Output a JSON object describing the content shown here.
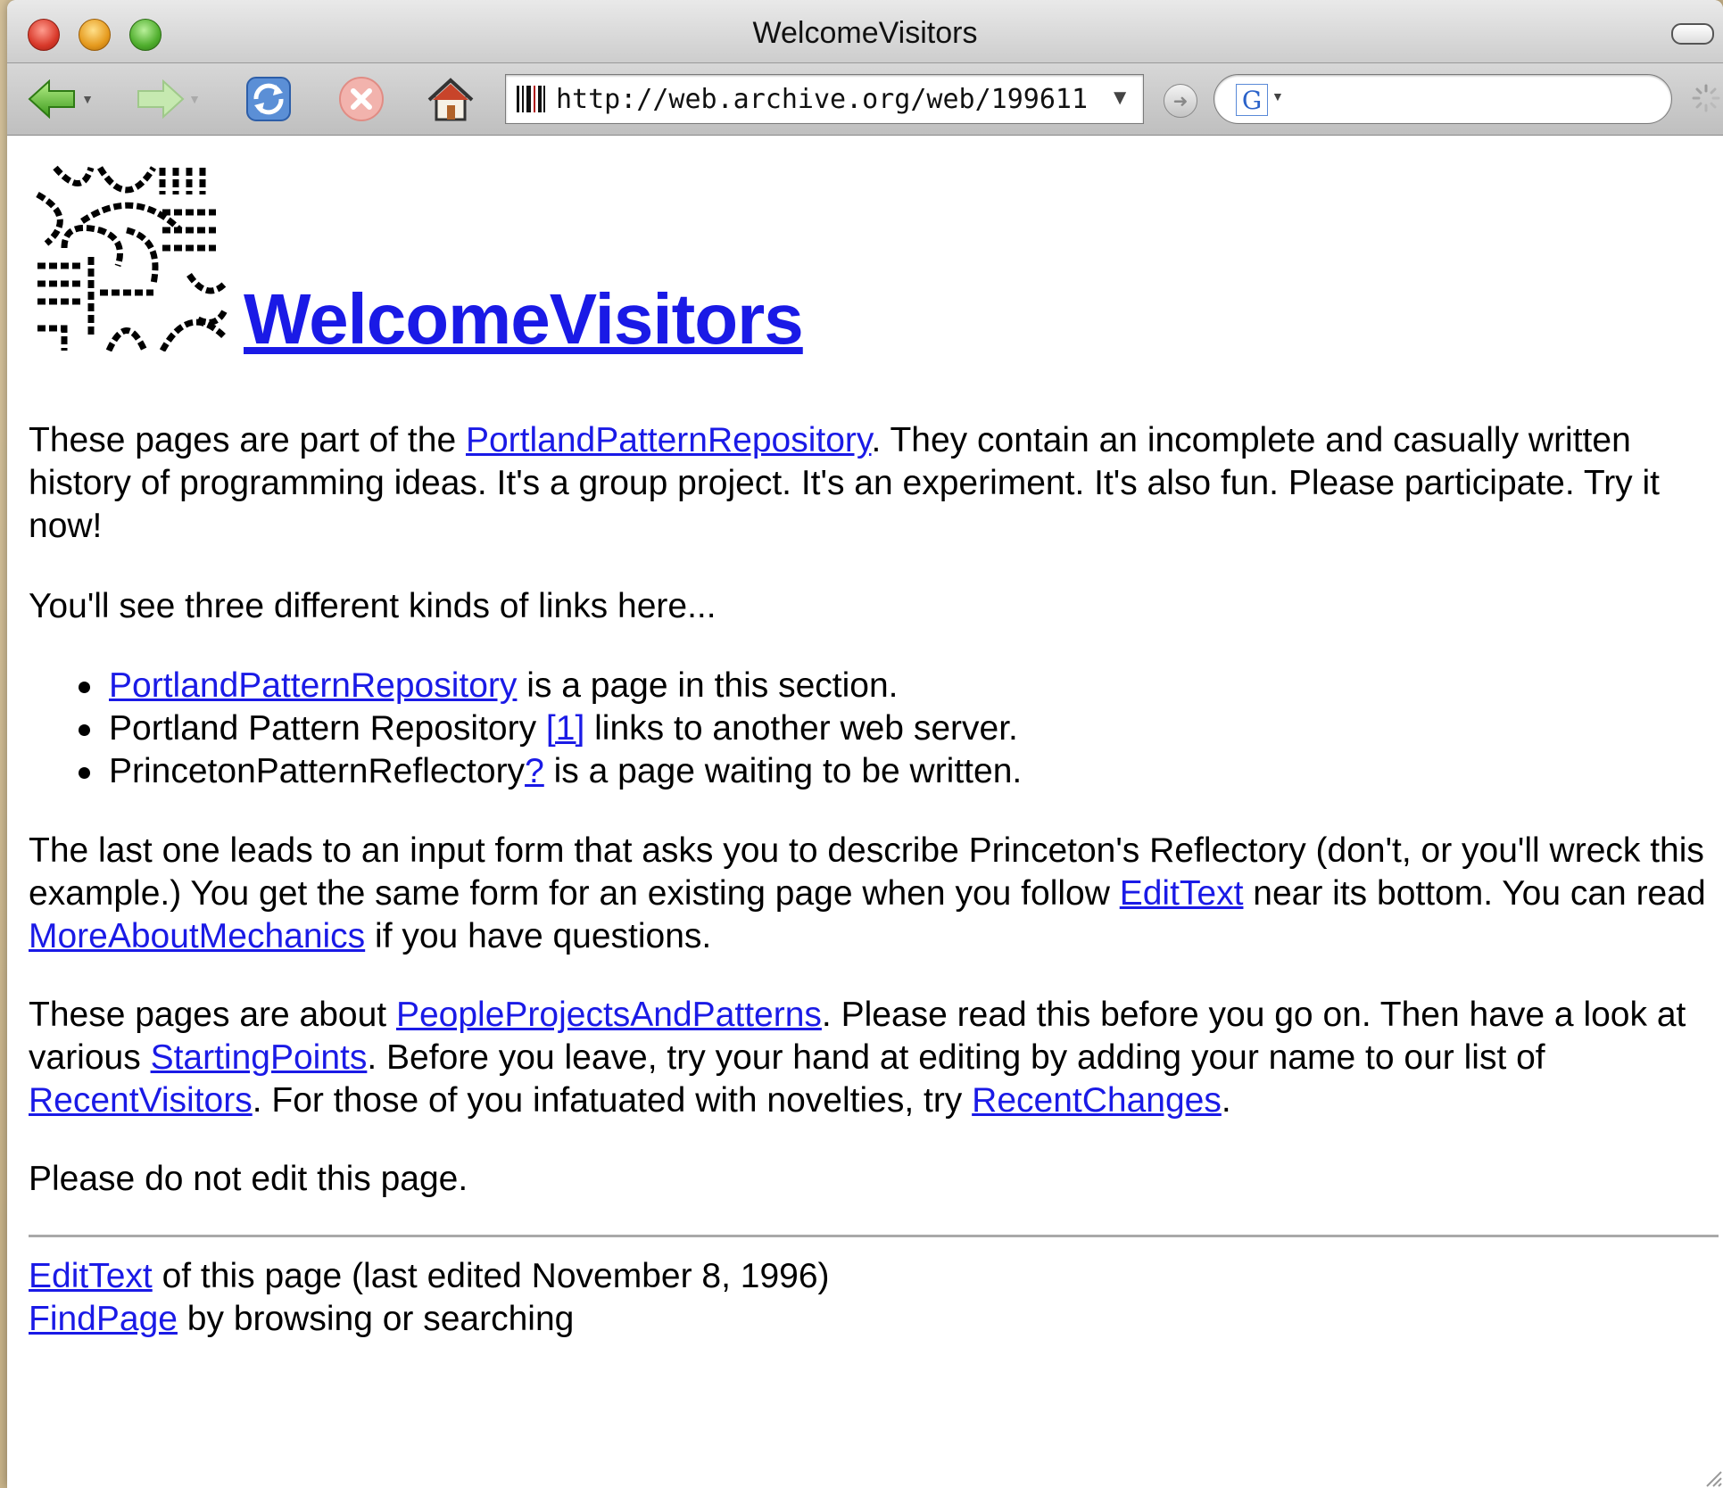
{
  "window": {
    "title": "WelcomeVisitors"
  },
  "toolbar": {
    "url": "http://web.archive.org/web/199611",
    "search_placeholder": "",
    "search_engine_letter": "G"
  },
  "page": {
    "heading": "WelcomeVisitors",
    "intro": {
      "t1": "These pages are part of the ",
      "link1": "PortlandPatternRepository",
      "t2": ". They contain an incomplete and casually written history of programming ideas. It's a group project. It's an experiment. It's also fun. Please participate. Try it now!"
    },
    "links_intro": "You'll see three different kinds of links here...",
    "list": [
      {
        "link": "PortlandPatternRepository",
        "text": " is a page in this section."
      },
      {
        "pre": "Portland Pattern Repository ",
        "link": "[1]",
        "text": " links to another web server."
      },
      {
        "pre": "PrincetonPatternReflectory",
        "link": "?",
        "text": " is a page waiting to be written."
      }
    ],
    "mechanics": {
      "t1": "The last one leads to an input form that asks you to describe Princeton's Reflectory (don't, or you'll wreck this example.) You get the same form for an existing page when you follow ",
      "link1": "EditText",
      "t2": " near its bottom. You can read ",
      "link2": "MoreAboutMechanics",
      "t3": " if you have questions."
    },
    "about": {
      "t1": "These pages are about ",
      "link1": "PeopleProjectsAndPatterns",
      "t2": ". Please read this before you go on. Then have a look at various ",
      "link2": "StartingPoints",
      "t3": ". Before you leave, try your hand at editing by adding your name to our list of ",
      "link3": "RecentVisitors",
      "t4": ". For those of you infatuated with novelties, try ",
      "link4": "RecentChanges",
      "t5": "."
    },
    "no_edit": "Please do not edit this page.",
    "footer": {
      "edit_link": "EditText",
      "edit_text": " of this page (last edited November 8, 1996)",
      "find_link": "FindPage",
      "find_text": " by browsing or searching"
    }
  },
  "colors": {
    "link": "#1a1ae6",
    "desktop": "#c9b48a",
    "divider": "#a9a9a9"
  },
  "icons": [
    "back-arrow-icon",
    "forward-arrow-icon",
    "reload-icon",
    "stop-icon",
    "home-icon",
    "barcode-site-icon",
    "go-icon",
    "google-icon",
    "spinner-icon",
    "wiki-logo"
  ]
}
